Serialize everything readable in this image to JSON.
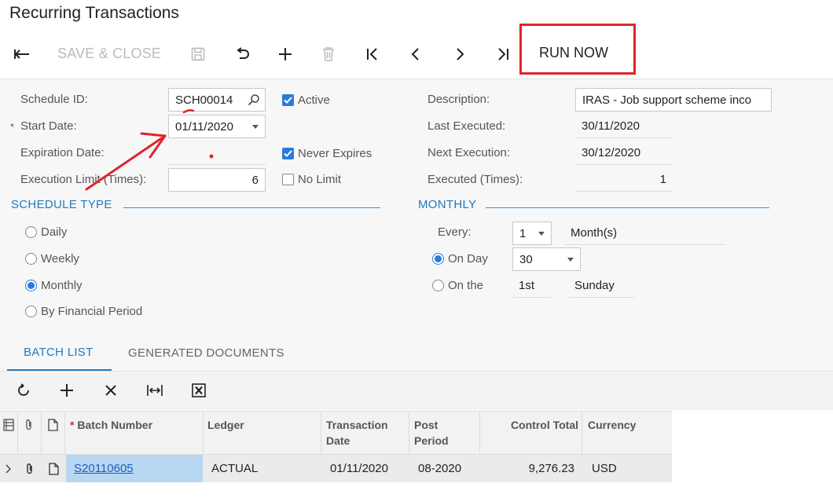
{
  "page_title": "Recurring Transactions",
  "toolbar": {
    "back_icon": "back-arrow-icon",
    "save_close_label": "SAVE & CLOSE",
    "save_icon": "save-icon",
    "undo_icon": "undo-icon",
    "add_icon": "plus-icon",
    "delete_icon": "trash-icon",
    "first_icon": "first-record-icon",
    "prev_icon": "chevron-left-icon",
    "next_icon": "chevron-right-icon",
    "last_icon": "last-record-icon",
    "run_now_label": "RUN NOW"
  },
  "form": {
    "schedule_id_label": "Schedule ID:",
    "schedule_id_value": "SCH00014",
    "active_label": "Active",
    "active_checked": true,
    "start_date_required": "*",
    "start_date_label": "Start Date:",
    "start_date_value": "01/11/2020",
    "expiration_date_label": "Expiration Date:",
    "never_expires_label": "Never Expires",
    "never_expires_checked": true,
    "execution_limit_label": "Execution Limit (Times):",
    "execution_limit_value": "6",
    "no_limit_label": "No Limit",
    "no_limit_checked": false,
    "description_label": "Description:",
    "description_value": "IRAS - Job support scheme inco",
    "last_executed_label": "Last Executed:",
    "last_executed_value": "30/11/2020",
    "next_execution_label": "Next Execution:",
    "next_execution_value": "30/12/2020",
    "executed_times_label": "Executed (Times):",
    "executed_times_value": "1"
  },
  "schedule_type": {
    "heading": "SCHEDULE TYPE",
    "options": [
      "Daily",
      "Weekly",
      "Monthly",
      "By Financial Period"
    ],
    "selected": "Monthly"
  },
  "monthly": {
    "heading": "MONTHLY",
    "every_label": "Every:",
    "every_value": "1",
    "every_unit": "Month(s)",
    "on_day_label": "On Day",
    "on_day_value": "30",
    "on_the_label": "On the",
    "on_the_ordinal": "1st",
    "on_the_weekday": "Sunday",
    "selected": "On Day"
  },
  "tabs": [
    {
      "label": "BATCH LIST",
      "active": true
    },
    {
      "label": "GENERATED DOCUMENTS",
      "active": false
    }
  ],
  "grid_toolbar": {
    "refresh_icon": "refresh-icon",
    "add_icon": "plus-icon",
    "delete_icon": "close-icon",
    "fit_icon": "fit-columns-icon",
    "excel_icon": "excel-export-icon"
  },
  "grid": {
    "header_icons": [
      "row-selector-icon",
      "paperclip-icon",
      "note-icon"
    ],
    "columns": {
      "batch_number_required": "*",
      "batch_number": "Batch Number",
      "ledger": "Ledger",
      "transaction_date_1": "Transaction",
      "transaction_date_2": "Date",
      "post_period_1": "Post",
      "post_period_2": "Period",
      "control_total": "Control Total",
      "currency": "Currency"
    },
    "rows": [
      {
        "batch_number": "S20110605",
        "ledger": "ACTUAL",
        "transaction_date": "01/11/2020",
        "post_period": "08-2020",
        "control_total": "9,276.23",
        "currency": "USD"
      }
    ]
  },
  "colors": {
    "accent": "#1f7ac2",
    "checkbox": "#2a7bd8",
    "annotation_red": "#e0242c",
    "selected_cell": "#b8d7f2"
  }
}
